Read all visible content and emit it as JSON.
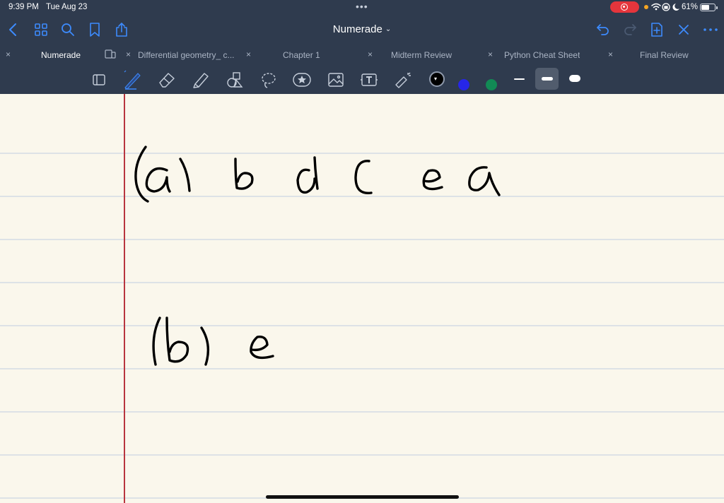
{
  "status_bar": {
    "time": "9:39 PM",
    "date": "Tue Aug 23",
    "battery_pct": "61%",
    "battery_level": 0.61,
    "multitask_dots": "•••"
  },
  "nav": {
    "title": "Numerade",
    "title_chevron": "⌄",
    "buttons": [
      "chevron-left-icon",
      "grid-icon",
      "search-icon",
      "bookmark-icon",
      "share-icon",
      "undo-icon",
      "redo-icon",
      "add-page-icon",
      "close-icon",
      "more-icon"
    ]
  },
  "tabs": [
    {
      "label": "Numerade",
      "active": true,
      "close": "×"
    },
    {
      "label": "Differential geometry_ c...",
      "active": false,
      "close": "×"
    },
    {
      "label": "Chapter 1",
      "active": false,
      "close": "×"
    },
    {
      "label": "Midterm Review",
      "active": false,
      "close": "×"
    },
    {
      "label": "Python Cheat Sheet",
      "active": false,
      "close": "×"
    },
    {
      "label": "Final Review",
      "active": false,
      "close": "×"
    }
  ],
  "toolbar": {
    "tools": [
      "read-only-icon",
      "pen-icon",
      "eraser-icon",
      "highlighter-icon",
      "shapes-icon",
      "lasso-icon",
      "sticker-icon",
      "image-icon",
      "text-tool-icon",
      "laser-pointer-icon"
    ],
    "selected_tool": "pen",
    "colors": {
      "black": "#000000",
      "blue": "#2626e8",
      "green": "#128a55"
    },
    "selected_color": "black",
    "stroke_widths": [
      "thin",
      "medium",
      "thick"
    ],
    "selected_width": "medium"
  },
  "page": {
    "paper_color": "#faf7ec",
    "rule_color": "#dde2e6",
    "margin_color": "#b8353f",
    "handwriting": [
      {
        "label": "(a)",
        "text": "b d c e a"
      },
      {
        "label": "(b)",
        "text": "e"
      }
    ]
  }
}
